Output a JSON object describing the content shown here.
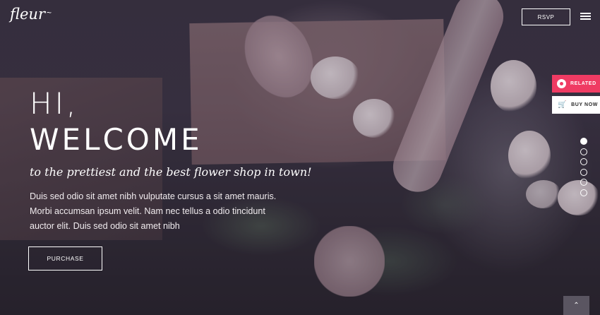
{
  "brand": {
    "logo_text": "fleur"
  },
  "header": {
    "rsvp_label": "RSVP",
    "menu_icon": "hamburger-menu-icon"
  },
  "hero": {
    "heading_line1": "HI,",
    "heading_line2": "WELCOME",
    "subtitle": "to the prettiest and the best flower shop in town!",
    "body_lines": [
      "Duis sed odio sit amet nibh vulputate cursus a sit amet mauris.",
      "Morbi accumsan ipsum velit. Nam nec tellus a odio tincidunt",
      "auctor elit. Duis sed odio sit amet nibh"
    ],
    "purchase_label": "PURCHASE"
  },
  "side_panel": {
    "related_label": "RELATED",
    "buy_now_label": "BUY NOW",
    "accent_color": "#ef3b63"
  },
  "slider": {
    "dot_count": 6,
    "active_index": 0
  },
  "scroll_top": {
    "icon": "chevron-up-icon"
  }
}
